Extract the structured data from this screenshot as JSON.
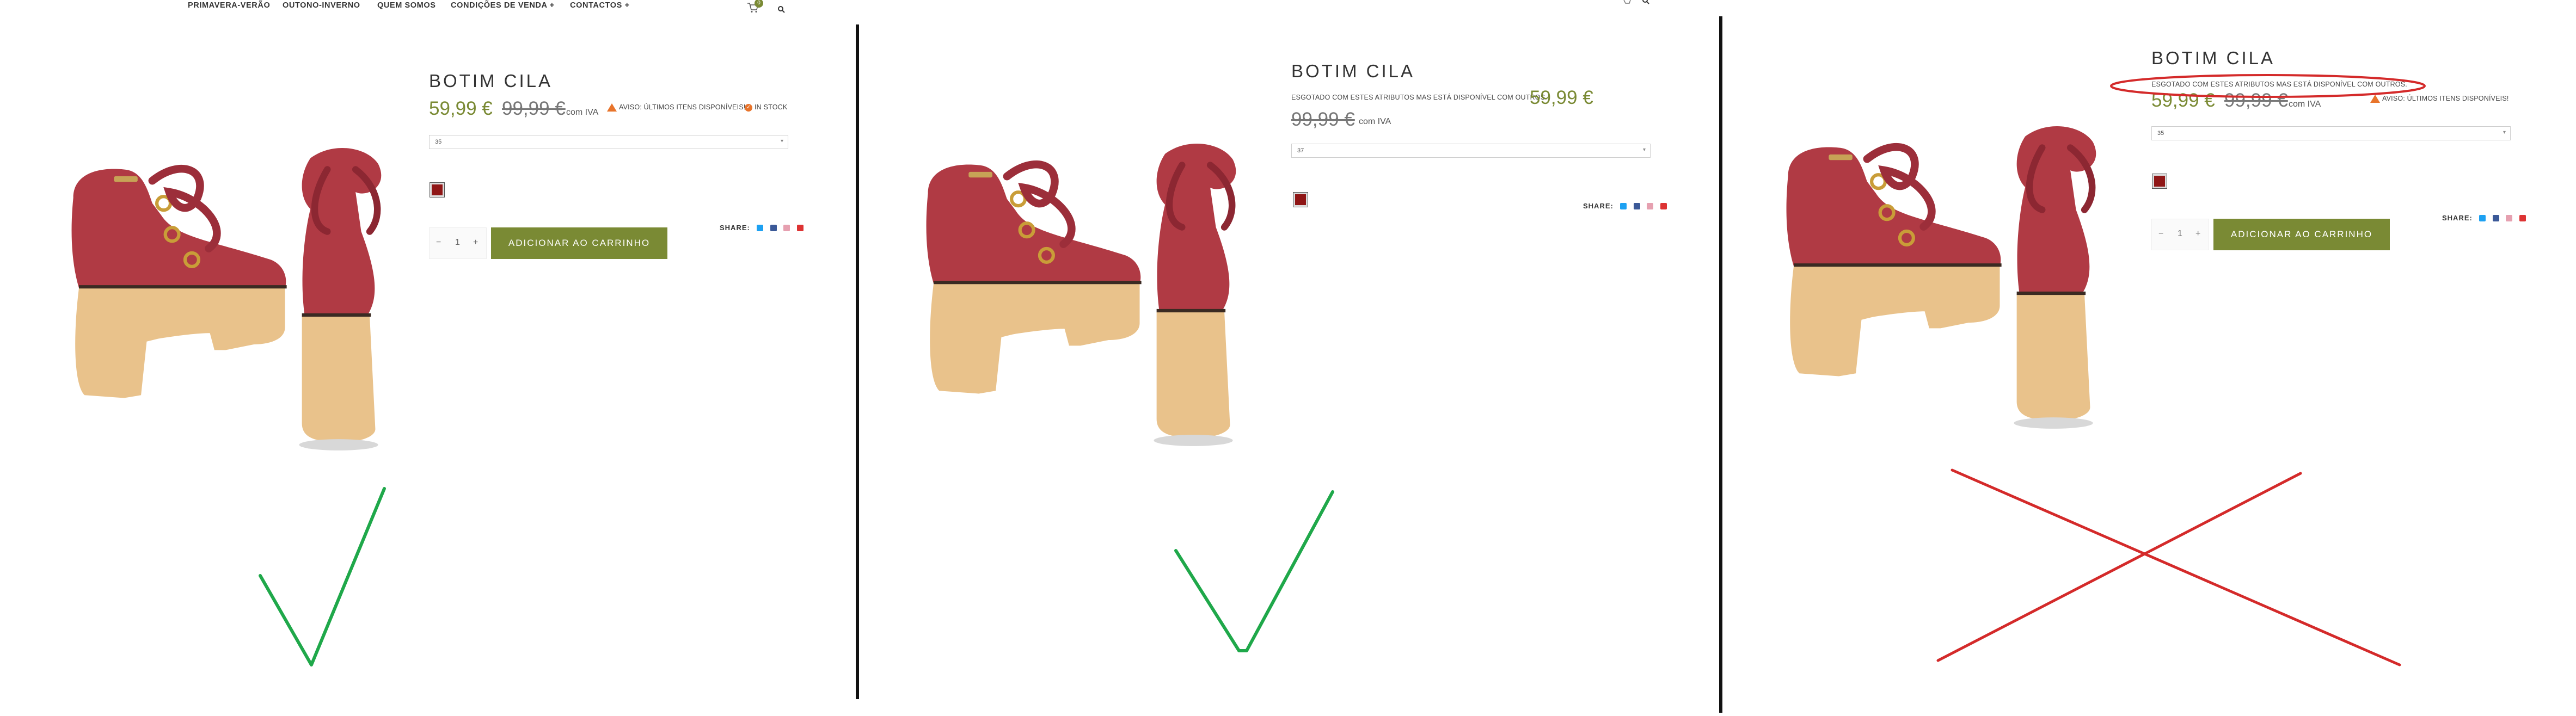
{
  "nav": {
    "items": [
      "PRIMAVERA-VERÃO",
      "OUTONO-INVERNO",
      "QUEM SOMOS",
      "CONDIÇÕES DE VENDA +",
      "CONTACTOS +"
    ],
    "cart_count": "0"
  },
  "colors": {
    "accent": "#7a8a34",
    "warning": "#e8742b",
    "swatch": "#8f1616",
    "check": "#1fa84a",
    "cross": "#d42a2a"
  },
  "panels": [
    {
      "title": "BOTIM CILA",
      "price_new": "59,99 €",
      "price_old": "99,99 €",
      "tax": "com IVA",
      "notice": "",
      "warning": "AVISO: ÚLTIMOS ITENS DISPONÍVEIS!",
      "stock": "IN STOCK",
      "size": "35",
      "qty": "1",
      "add_to_cart": "ADICIONAR AO CARRINHO",
      "share": "SHARE:",
      "verdict": "check"
    },
    {
      "title": "BOTIM CILA",
      "price_new": "59,99 €",
      "price_old": "99,99 €",
      "tax": "com IVA",
      "notice": "ESGOTADO COM ESTES ATRIBUTOS MAS ESTÁ DISPONÍVEL COM OUTROS.",
      "warning": "",
      "stock": "",
      "size": "37",
      "qty": "",
      "add_to_cart": "",
      "share": "SHARE:",
      "verdict": "check"
    },
    {
      "title": "BOTIM CILA",
      "price_new": "59,99 €",
      "price_old": "99,99 €",
      "tax": "com IVA",
      "notice": "ESGOTADO COM ESTES ATRIBUTOS MAS ESTÁ DISPONÍVEL COM OUTROS.",
      "warning": "AVISO: ÚLTIMOS ITENS DISPONÍVEIS!",
      "stock": "",
      "size": "35",
      "qty": "1",
      "add_to_cart": "ADICIONAR AO CARRINHO",
      "share": "SHARE:",
      "verdict": "cross"
    }
  ]
}
